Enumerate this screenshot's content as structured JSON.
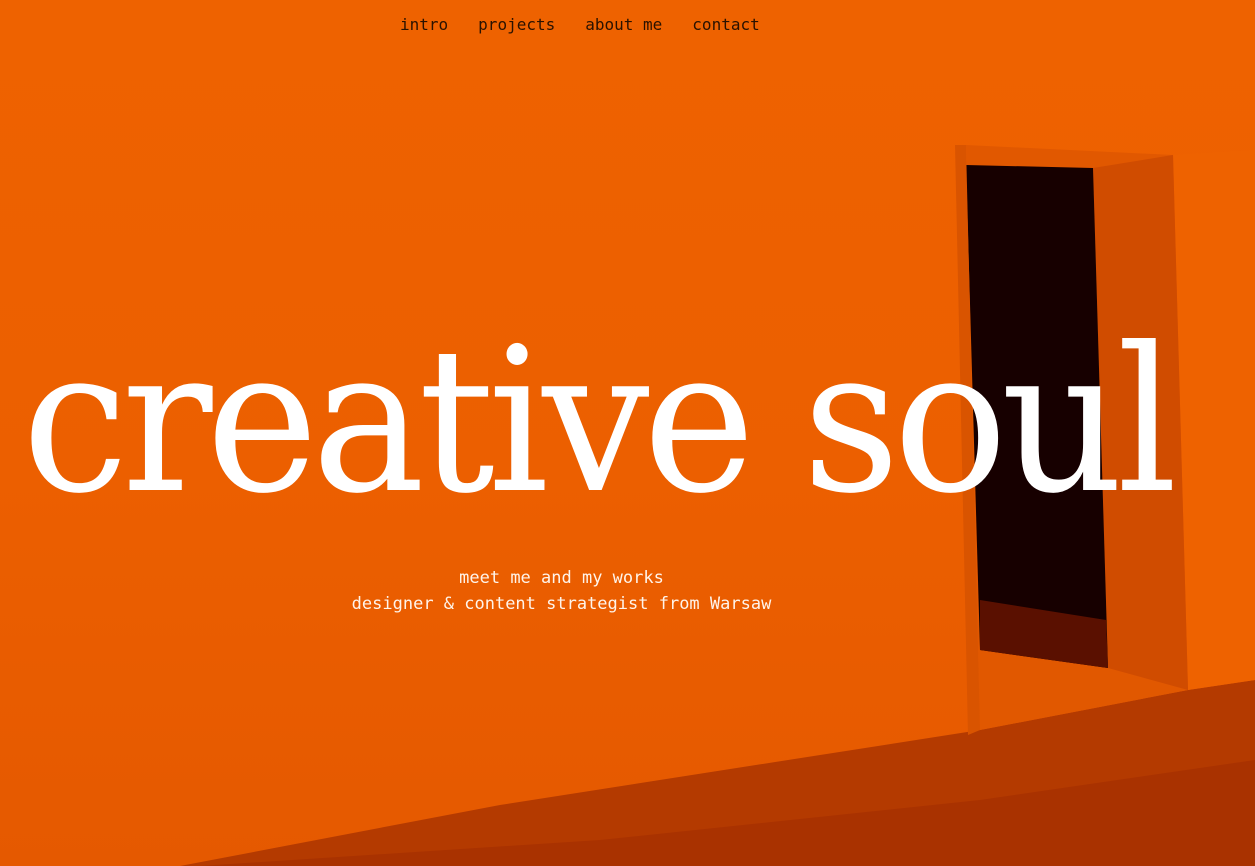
{
  "nav": {
    "items": [
      {
        "label": "intro"
      },
      {
        "label": "projects"
      },
      {
        "label": "about me"
      },
      {
        "label": "contact"
      }
    ]
  },
  "hero": {
    "headline": "creative soul",
    "tagline": "meet me and my works",
    "description": "designer & content strategist from Warsaw"
  },
  "colors": {
    "background": "#ec6100",
    "headline_text": "#ffffff",
    "nav_text": "#2a1200",
    "doorway": "#170000",
    "floor": "#a82e00"
  }
}
